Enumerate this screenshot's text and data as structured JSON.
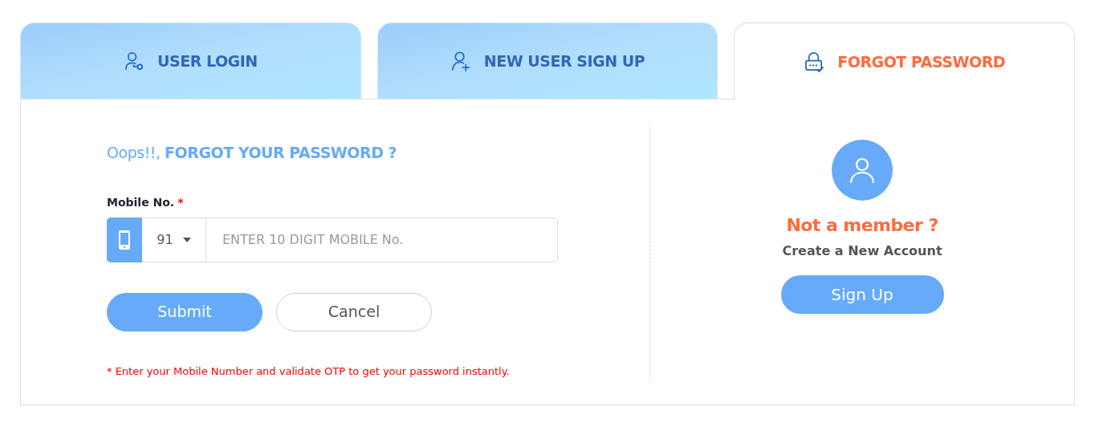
{
  "tabs": [
    {
      "label": "USER LOGIN",
      "kind": "user-key",
      "selected": false
    },
    {
      "label": "NEW USER SIGN UP",
      "kind": "user-plus",
      "selected": false
    },
    {
      "label": "FORGOT PASSWORD",
      "kind": "lock",
      "selected": true
    }
  ],
  "form": {
    "heading": "Oops!!, **FORGOT YOUR PASSWORD ?**",
    "mobile_label": "Mobile No.",
    "required_mark": "*",
    "country_code": "91",
    "mobile_field": {
      "placeholder": "ENTER 10 DIGIT MOBILE No."
    },
    "buttons": [
      {
        "label": "Submit",
        "kind": "primary"
      },
      {
        "label": "Cancel",
        "kind": "secondary"
      }
    ],
    "note": "* Enter your Mobile Number and validate OTP to get your password instantly."
  },
  "signup_panel": {
    "title": "Not a member ?",
    "subtitle": "Create a New Account",
    "button": "Sign Up"
  }
}
